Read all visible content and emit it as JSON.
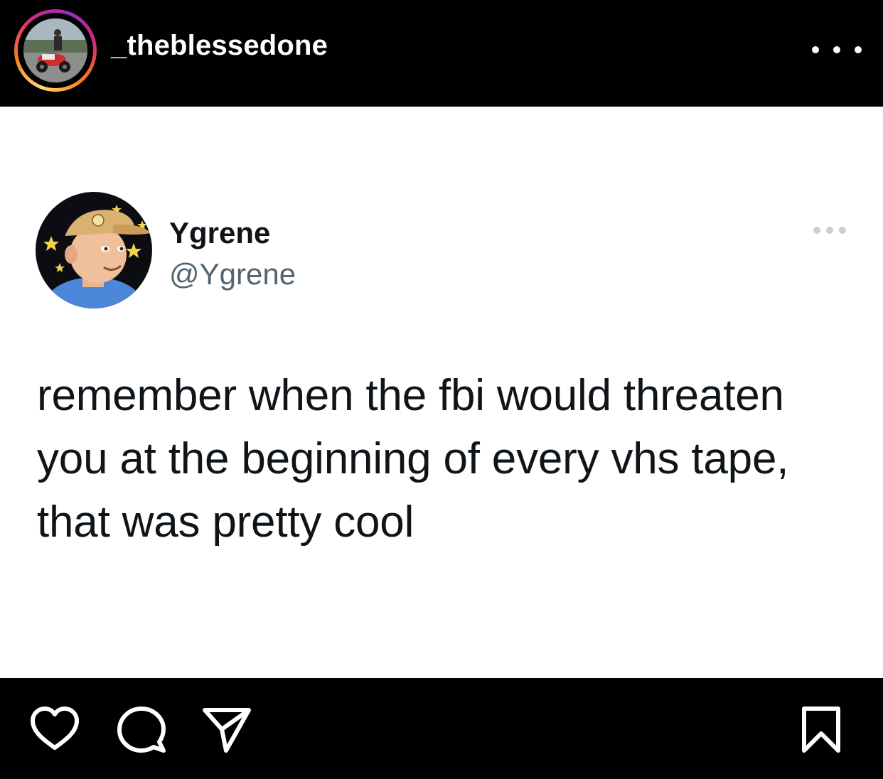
{
  "post_header": {
    "username": "_theblessedone",
    "avatar_icon": "avatar-photo",
    "more_icon": "more-options-icon"
  },
  "tweet": {
    "display_name": "Ygrene",
    "handle": "@Ygrene",
    "avatar_icon": "cartoon-avatar",
    "more_icon": "more-options-icon",
    "text": "remember when the fbi would threaten you at the beginning of every vhs tape, that was pretty cool"
  },
  "actions": {
    "like_icon": "heart-icon",
    "comment_icon": "comment-icon",
    "share_icon": "send-icon",
    "save_icon": "bookmark-icon"
  },
  "colors": {
    "background": "#000000",
    "card": "#ffffff",
    "text_primary": "#0f1419",
    "text_secondary": "#536471",
    "story_ring": [
      "#feda75",
      "#fa7e1e",
      "#d62976",
      "#962fbf"
    ]
  }
}
